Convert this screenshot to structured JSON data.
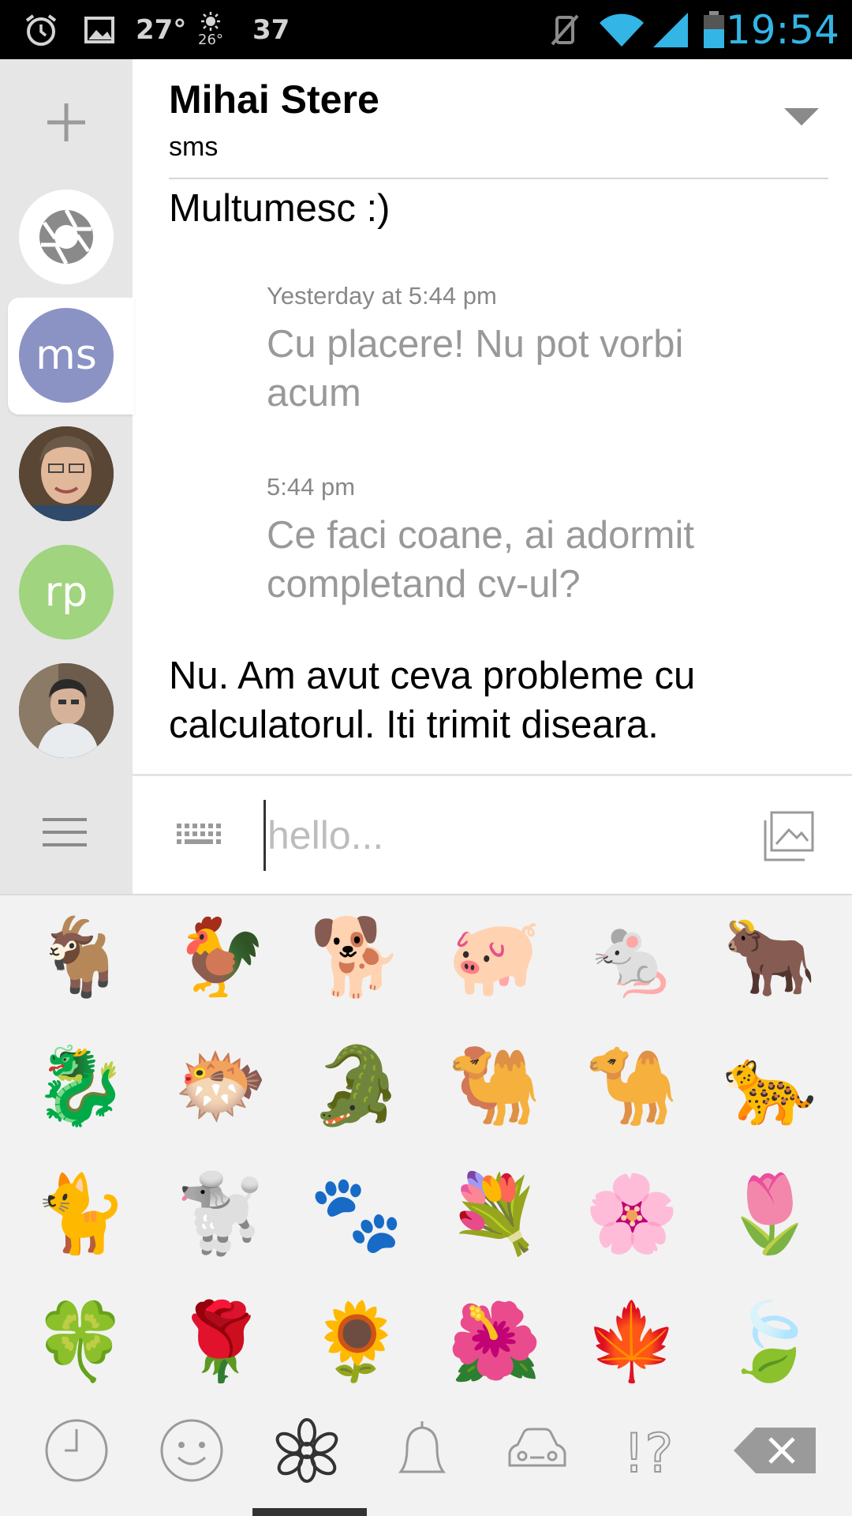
{
  "status_bar": {
    "temperature": "27°",
    "forecast_temp": "26°",
    "notification_count": "37",
    "time": "19:54"
  },
  "conversation": {
    "contact_name": "Mihai Stere",
    "contact_type": "sms",
    "messages": [
      {
        "direction": "out",
        "text": "Multumesc :)"
      },
      {
        "direction": "in",
        "time": "Yesterday at 5:44 pm",
        "text": " Cu placere! Nu pot vorbi acum"
      },
      {
        "direction": "in",
        "time": "5:44 pm",
        "text": "Ce faci coane, ai adormit completand cv-ul?"
      },
      {
        "direction": "out",
        "text": "Nu. Am avut ceva probleme cu calculatorul. Iti trimit diseara."
      }
    ]
  },
  "sidebar": {
    "avatars": [
      {
        "initials": "",
        "kind": "camera",
        "color": "#ffffff"
      },
      {
        "initials": "ms",
        "kind": "initials",
        "color": "#8b92c4",
        "selected": true
      },
      {
        "initials": "",
        "kind": "photo"
      },
      {
        "initials": "rp",
        "kind": "initials",
        "color": "#a0d47e"
      },
      {
        "initials": "",
        "kind": "photo"
      }
    ]
  },
  "compose": {
    "placeholder": "hello..."
  },
  "emoji_grid": [
    [
      "🐐",
      "🐓",
      "🐕",
      "🐖",
      "🐁",
      "🐂"
    ],
    [
      "🐉",
      "🐡",
      "🐊",
      "🐫",
      "🐪",
      "🐆"
    ],
    [
      "🐈",
      "🐩",
      "🐾",
      "💐",
      "🌸",
      "🌷"
    ],
    [
      "🍀",
      "🌹",
      "🌻",
      "🌺",
      "🍁",
      "🍃"
    ]
  ],
  "emoji_categories": [
    "recent-icon",
    "smiley-icon",
    "flower-icon",
    "bell-icon",
    "car-icon",
    "symbols-icon"
  ],
  "selected_category": "flower-icon",
  "colors": {
    "accent": "#33b5e5",
    "sidebar_bg": "#e6e6e6",
    "emoji_panel_bg": "#f2f2f2"
  }
}
